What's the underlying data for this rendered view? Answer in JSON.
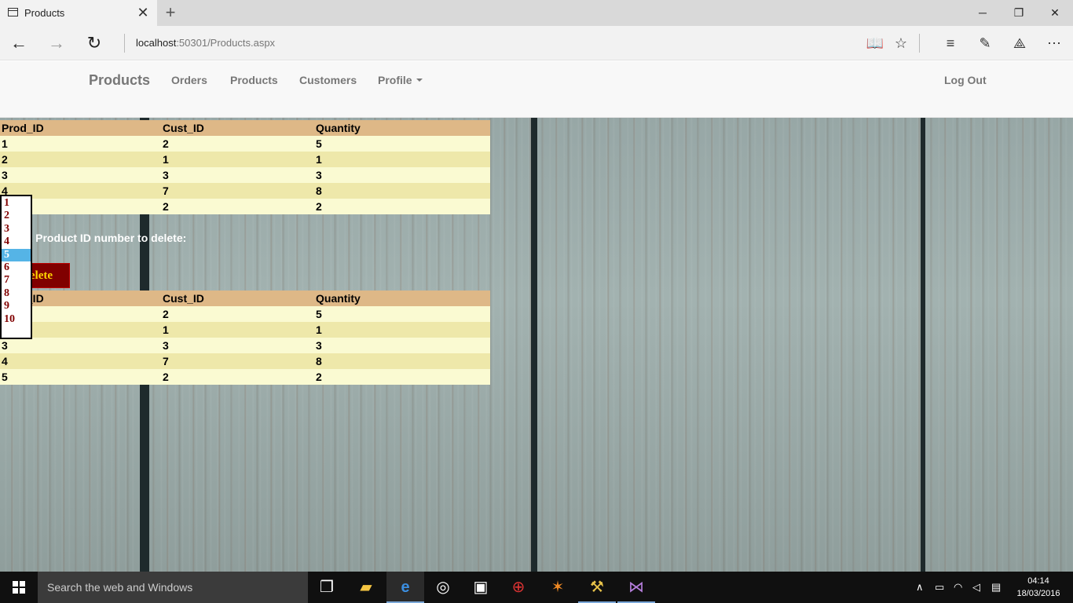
{
  "browser": {
    "tab_title": "Products",
    "tab_close": "✕",
    "new_tab": "+",
    "url_host": "localhost",
    "url_rest": ":50301/Products.aspx",
    "window_controls": {
      "minimize": "─",
      "restore": "❐",
      "close": "✕"
    }
  },
  "site": {
    "brand": "Products",
    "nav": [
      {
        "label": "Orders"
      },
      {
        "label": "Products"
      },
      {
        "label": "Customers"
      },
      {
        "label": "Profile"
      }
    ],
    "logout": "Log Out"
  },
  "grid1": {
    "headers": [
      "Prod_ID",
      "Cust_ID",
      "Quantity"
    ],
    "rows": [
      [
        "1",
        "2",
        "5"
      ],
      [
        "2",
        "1",
        "1"
      ],
      [
        "3",
        "3",
        "3"
      ],
      [
        "4",
        "7",
        "8"
      ],
      [
        "5",
        "2",
        "2"
      ]
    ]
  },
  "delete": {
    "label": "Select Product ID number to delete:",
    "button": "Delete",
    "options": [
      "1",
      "2",
      "3",
      "4",
      "5",
      "6",
      "7",
      "8",
      "9",
      "10"
    ],
    "selected": "5",
    "selected_color": "#55b4e6"
  },
  "grid2": {
    "headers": [
      "Prod_ID",
      "Cust_ID",
      "Quantity"
    ],
    "rows": [
      [
        "1",
        "2",
        "5"
      ],
      [
        "2",
        "1",
        "1"
      ],
      [
        "3",
        "3",
        "3"
      ],
      [
        "4",
        "7",
        "8"
      ],
      [
        "5",
        "2",
        "2"
      ]
    ]
  },
  "taskbar": {
    "search_placeholder": "Search the web and Windows",
    "time": "04:14",
    "date": "18/03/2016"
  },
  "colors": {
    "header": "#deb887",
    "row_odd": "#fafad2",
    "row_even": "#eee8aa",
    "button_bg": "#800000",
    "button_text": "#ffd700"
  }
}
